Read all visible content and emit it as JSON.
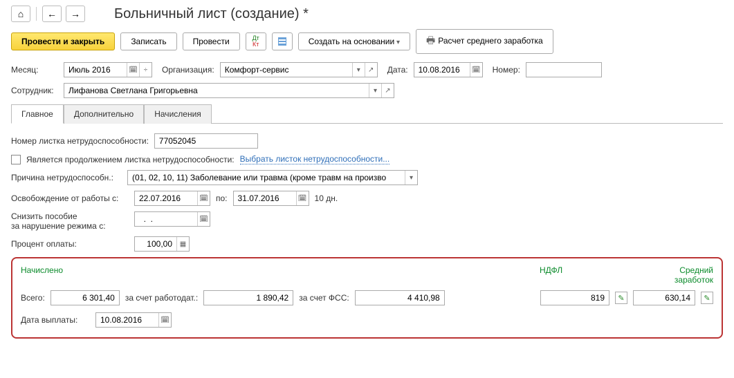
{
  "page": {
    "title": "Больничный лист (создание) *"
  },
  "toolbar": {
    "post_close": "Провести и закрыть",
    "save": "Записать",
    "post": "Провести",
    "create_based": "Создать на основании",
    "avg_salary": "Расчет среднего заработка"
  },
  "header": {
    "month_label": "Месяц:",
    "month_value": "Июль 2016",
    "org_label": "Организация:",
    "org_value": "Комфорт-сервис",
    "date_label": "Дата:",
    "date_value": "10.08.2016",
    "number_label": "Номер:",
    "number_value": "",
    "employee_label": "Сотрудник:",
    "employee_value": "Лифанова Светлана Григорьевна"
  },
  "tabs": {
    "main": "Главное",
    "extra": "Дополнительно",
    "accruals": "Начисления"
  },
  "main": {
    "sheet_no_label": "Номер листка нетрудоспособности:",
    "sheet_no_value": "77052045",
    "is_continuation_label": "Является продолжением листка нетрудоспособности:",
    "choose_sheet_link": "Выбрать листок нетрудоспособности...",
    "reason_label": "Причина нетрудоспособн.:",
    "reason_value": "(01, 02, 10, 11) Заболевание или травма (кроме травм на произво",
    "release_from_label": "Освобождение от работы с:",
    "release_from_value": "22.07.2016",
    "release_to_label": "по:",
    "release_to_value": "31.07.2016",
    "days_text": "10 дн.",
    "reduce_label_1": "Снизить пособие",
    "reduce_label_2": "за нарушение режима с:",
    "reduce_value": "  .  .",
    "percent_label": "Процент оплаты:",
    "percent_value": "100,00"
  },
  "summary": {
    "accrued_label": "Начислено",
    "ndfl_label": "НДФЛ",
    "avg_label": "Средний заработок",
    "total_label": "Всего:",
    "total_value": "6 301,40",
    "employer_label": "за счет работодат.:",
    "employer_value": "1 890,42",
    "fss_label": "за счет ФСС:",
    "fss_value": "4 410,98",
    "ndfl_value": "819",
    "avg_value": "630,14",
    "paydate_label": "Дата выплаты:",
    "paydate_value": "10.08.2016"
  }
}
